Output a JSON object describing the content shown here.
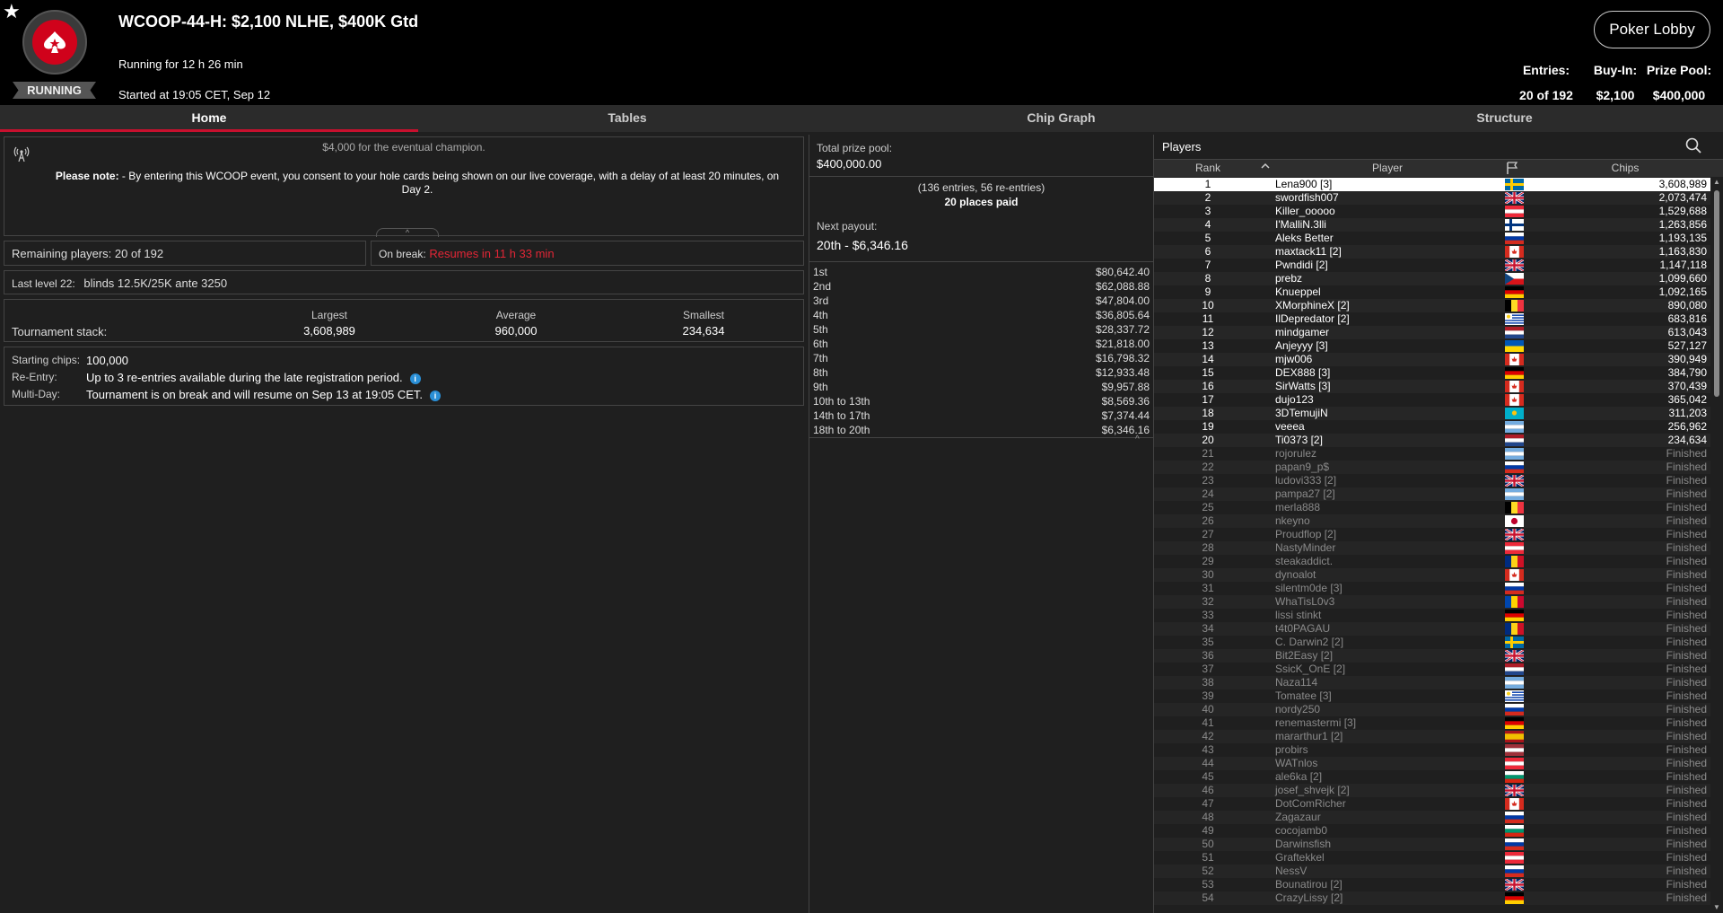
{
  "header": {
    "star": "★",
    "status_badge": "RUNNING",
    "title": "WCOOP-44-H: $2,100 NLHE, $400K Gtd",
    "running_for": "Running for 12 h 26 min",
    "started_at": "Started at 19:05 CET, Sep 12",
    "lobby_button": "Poker Lobby",
    "entries_label": "Entries:",
    "entries_value": "20 of 192",
    "buyin_label": "Buy-In:",
    "buyin_value": "$2,100",
    "prizepool_label": "Prize Pool:",
    "prizepool_value": "$400,000"
  },
  "tabs": [
    "Home",
    "Tables",
    "Chip Graph",
    "Structure"
  ],
  "notice": {
    "truncated_line": "$4,000 for the eventual champion.",
    "bold_prefix": "Please note:",
    "text": " - By entering this WCOOP event, you consent to your hole cards being shown on our live coverage, with a delay of at least 20 minutes, on Day 2."
  },
  "remaining": "Remaining players: 20 of 192",
  "on_break": {
    "label": "On break:",
    "value": "Resumes in 11 h 33 min"
  },
  "last_level": {
    "label": "Last level 22:",
    "value": "blinds 12.5K/25K ante 3250"
  },
  "stack": {
    "label": "Tournament stack:",
    "largest_label": "Largest",
    "largest": "3,608,989",
    "average_label": "Average",
    "average": "960,000",
    "smallest_label": "Smallest",
    "smallest": "234,634"
  },
  "info": {
    "starting_label": "Starting chips:",
    "starting": "100,000",
    "reentry_label": "Re-Entry:",
    "reentry": "Up to 3 re-entries available during the late registration period.",
    "multiday_label": "Multi-Day:",
    "multiday": "Tournament is on break and will resume on Sep 13 at 19:05 CET."
  },
  "prize": {
    "total_label": "Total prize pool:",
    "total": "$400,000.00",
    "entries_note": "(136 entries, 56 re-entries)",
    "places_paid": "20 places paid",
    "next_label": "Next payout:",
    "next_value": "20th - $6,346.16",
    "payouts": [
      {
        "place": "1st",
        "amount": "$80,642.40"
      },
      {
        "place": "2nd",
        "amount": "$62,088.88"
      },
      {
        "place": "3rd",
        "amount": "$47,804.00"
      },
      {
        "place": "4th",
        "amount": "$36,805.64"
      },
      {
        "place": "5th",
        "amount": "$28,337.72"
      },
      {
        "place": "6th",
        "amount": "$21,818.00"
      },
      {
        "place": "7th",
        "amount": "$16,798.32"
      },
      {
        "place": "8th",
        "amount": "$12,933.48"
      },
      {
        "place": "9th",
        "amount": "$9,957.88"
      },
      {
        "place": "10th to 13th",
        "amount": "$8,569.36"
      },
      {
        "place": "14th to 17th",
        "amount": "$7,374.44"
      },
      {
        "place": "18th to 20th",
        "amount": "$6,346.16"
      }
    ]
  },
  "players_panel": {
    "title": "Players",
    "col_rank": "Rank",
    "col_player": "Player",
    "col_chips": "Chips",
    "rows": [
      {
        "rank": "1",
        "name": "Lena900 [3]",
        "flag": "se",
        "chips": "3,608,989"
      },
      {
        "rank": "2",
        "name": "swordfish007",
        "flag": "gb",
        "chips": "2,073,474"
      },
      {
        "rank": "3",
        "name": "Killer_ooooo",
        "flag": "at",
        "chips": "1,529,688"
      },
      {
        "rank": "4",
        "name": "I'MalliN.3lli",
        "flag": "fi",
        "chips": "1,263,856"
      },
      {
        "rank": "5",
        "name": "Aleks Better",
        "flag": "ru",
        "chips": "1,193,135"
      },
      {
        "rank": "6",
        "name": "maxtack11 [2]",
        "flag": "ca",
        "chips": "1,163,830"
      },
      {
        "rank": "7",
        "name": "Pwndidi [2]",
        "flag": "gb",
        "chips": "1,147,118"
      },
      {
        "rank": "8",
        "name": "prebz",
        "flag": "cz",
        "chips": "1,099,660"
      },
      {
        "rank": "9",
        "name": "Knueppel",
        "flag": "de",
        "chips": "1,092,165"
      },
      {
        "rank": "10",
        "name": "XMorphineX [2]",
        "flag": "be",
        "chips": "890,080"
      },
      {
        "rank": "11",
        "name": "IlDepredator [2]",
        "flag": "uy",
        "chips": "683,816"
      },
      {
        "rank": "12",
        "name": "mindgamer",
        "flag": "nl",
        "chips": "613,043"
      },
      {
        "rank": "13",
        "name": "Anjeyyy [3]",
        "flag": "ua",
        "chips": "527,127"
      },
      {
        "rank": "14",
        "name": "mjw006",
        "flag": "ca",
        "chips": "390,949"
      },
      {
        "rank": "15",
        "name": "DEX888 [3]",
        "flag": "de",
        "chips": "384,790"
      },
      {
        "rank": "16",
        "name": "SirWatts [3]",
        "flag": "ca",
        "chips": "370,439"
      },
      {
        "rank": "17",
        "name": "dujo123",
        "flag": "ca",
        "chips": "365,042"
      },
      {
        "rank": "18",
        "name": "3DTemujiN",
        "flag": "kz",
        "chips": "311,203"
      },
      {
        "rank": "19",
        "name": "veeea",
        "flag": "ar",
        "chips": "256,962"
      },
      {
        "rank": "20",
        "name": "Ti0373 [2]",
        "flag": "nl",
        "chips": "234,634"
      },
      {
        "rank": "21",
        "name": "rojorulez",
        "flag": "ar",
        "chips": "Finished"
      },
      {
        "rank": "22",
        "name": "papan9_p$",
        "flag": "ru",
        "chips": "Finished"
      },
      {
        "rank": "23",
        "name": "ludovi333 [2]",
        "flag": "gb",
        "chips": "Finished"
      },
      {
        "rank": "24",
        "name": "pampa27 [2]",
        "flag": "ar",
        "chips": "Finished"
      },
      {
        "rank": "25",
        "name": "merla888",
        "flag": "be",
        "chips": "Finished"
      },
      {
        "rank": "26",
        "name": "nkeyno",
        "flag": "jp",
        "chips": "Finished"
      },
      {
        "rank": "27",
        "name": "Proudflop [2]",
        "flag": "gb",
        "chips": "Finished"
      },
      {
        "rank": "28",
        "name": "NastyMinder",
        "flag": "at",
        "chips": "Finished"
      },
      {
        "rank": "29",
        "name": "steakaddict.",
        "flag": "ro",
        "chips": "Finished"
      },
      {
        "rank": "30",
        "name": "dynoalot",
        "flag": "ca",
        "chips": "Finished"
      },
      {
        "rank": "31",
        "name": "silentm0de [3]",
        "flag": "ru",
        "chips": "Finished"
      },
      {
        "rank": "32",
        "name": "WhaTisL0v3",
        "flag": "md",
        "chips": "Finished"
      },
      {
        "rank": "33",
        "name": "lissi stinkt",
        "flag": "de",
        "chips": "Finished"
      },
      {
        "rank": "34",
        "name": "t4t0PAGAU",
        "flag": "ro",
        "chips": "Finished"
      },
      {
        "rank": "35",
        "name": "C. Darwin2 [2]",
        "flag": "se",
        "chips": "Finished"
      },
      {
        "rank": "36",
        "name": "Bit2Easy [2]",
        "flag": "gb",
        "chips": "Finished"
      },
      {
        "rank": "37",
        "name": "SsicK_OnE [2]",
        "flag": "nl",
        "chips": "Finished"
      },
      {
        "rank": "38",
        "name": "Naza114",
        "flag": "ar",
        "chips": "Finished"
      },
      {
        "rank": "39",
        "name": "Tomatee [3]",
        "flag": "uy",
        "chips": "Finished"
      },
      {
        "rank": "40",
        "name": "nordy250",
        "flag": "ru",
        "chips": "Finished"
      },
      {
        "rank": "41",
        "name": "renemastermi [3]",
        "flag": "de",
        "chips": "Finished"
      },
      {
        "rank": "42",
        "name": "mararthur1 [2]",
        "flag": "es",
        "chips": "Finished"
      },
      {
        "rank": "43",
        "name": "probirs",
        "flag": "lv",
        "chips": "Finished"
      },
      {
        "rank": "44",
        "name": "WATnlos",
        "flag": "at",
        "chips": "Finished"
      },
      {
        "rank": "45",
        "name": "ale6ka [2]",
        "flag": "bg",
        "chips": "Finished"
      },
      {
        "rank": "46",
        "name": "josef_shvejk [2]",
        "flag": "gb",
        "chips": "Finished"
      },
      {
        "rank": "47",
        "name": "DotComRicher",
        "flag": "ca",
        "chips": "Finished"
      },
      {
        "rank": "48",
        "name": "Zagazaur",
        "flag": "ru",
        "chips": "Finished"
      },
      {
        "rank": "49",
        "name": "cocojamb0",
        "flag": "bg",
        "chips": "Finished"
      },
      {
        "rank": "50",
        "name": "Darwinsfish",
        "flag": "ru",
        "chips": "Finished"
      },
      {
        "rank": "51",
        "name": "Graftekkel",
        "flag": "at",
        "chips": "Finished"
      },
      {
        "rank": "52",
        "name": "NessV",
        "flag": "ru",
        "chips": "Finished"
      },
      {
        "rank": "53",
        "name": "Bounatirou [2]",
        "flag": "gb",
        "chips": "Finished"
      },
      {
        "rank": "54",
        "name": "CrazyLissy [2]",
        "flag": "de",
        "chips": "Finished"
      }
    ]
  },
  "colors": {
    "accent_red": "#c8102e",
    "break_red": "#e32636",
    "background": "#1f1f1f",
    "header_bg": "#000000"
  }
}
